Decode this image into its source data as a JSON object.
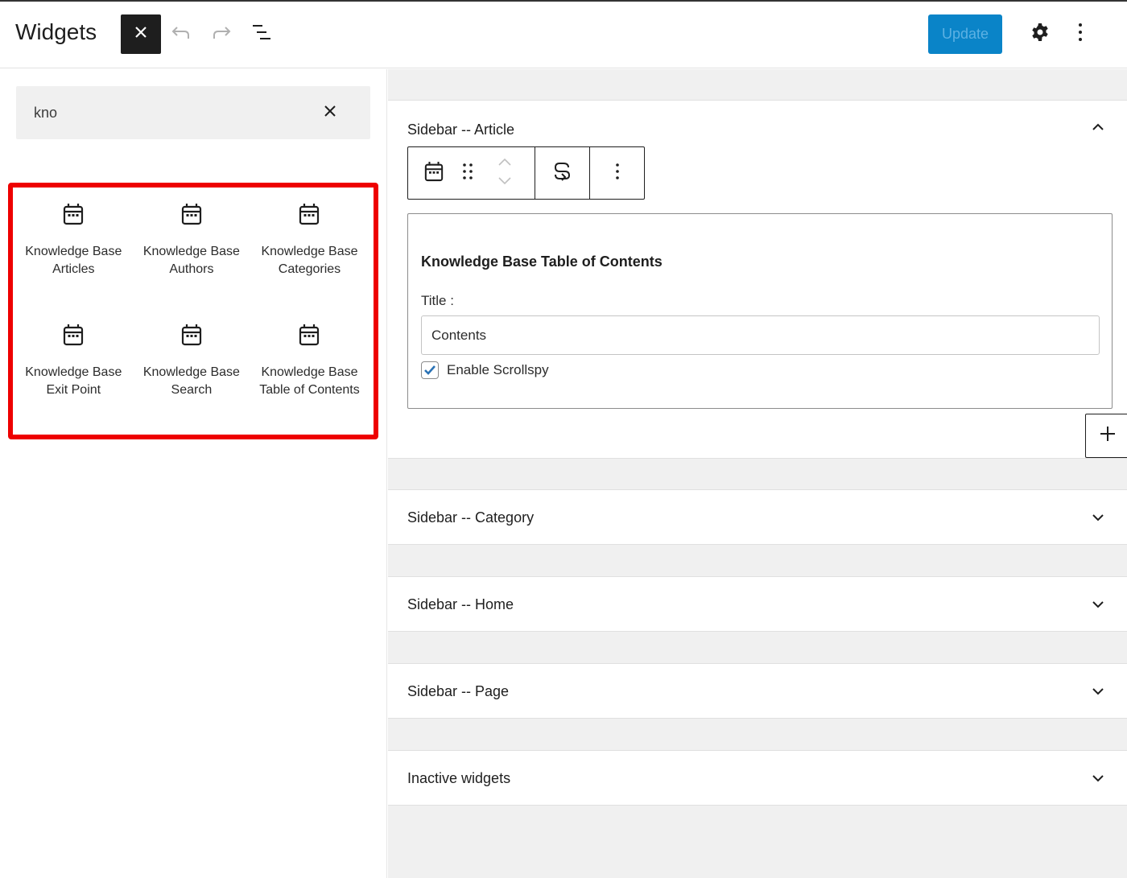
{
  "header": {
    "title": "Widgets",
    "close_inserter_icon": "close-icon",
    "undo_icon": "undo-icon",
    "redo_icon": "redo-icon",
    "list_view_icon": "list-view-icon",
    "update_label": "Update",
    "settings_icon": "gear-icon",
    "options_icon": "more-vertical-icon",
    "colors": {
      "update_bg": "#0a84c8",
      "update_text": "#5db1e3"
    }
  },
  "inserter": {
    "search": {
      "value": "kno",
      "placeholder": "Search"
    },
    "blocks": [
      {
        "label": "Knowledge Base Articles",
        "icon": "calendar-icon"
      },
      {
        "label": "Knowledge Base Authors",
        "icon": "calendar-icon"
      },
      {
        "label": "Knowledge Base Categories",
        "icon": "calendar-icon"
      },
      {
        "label": "Knowledge Base Exit Point",
        "icon": "calendar-icon"
      },
      {
        "label": "Knowledge Base Search",
        "icon": "calendar-icon"
      },
      {
        "label": "Knowledge Base Table of Contents",
        "icon": "calendar-icon"
      }
    ],
    "highlight_color": "#ee0000"
  },
  "widget_areas": {
    "article": {
      "title": "Sidebar -- Article",
      "expanded": true,
      "widget": {
        "heading": "Knowledge Base Table of Contents",
        "title_label": "Title :",
        "title_value": "Contents",
        "scrollspy_label": "Enable Scrollspy",
        "scrollspy_checked": true
      }
    },
    "collapsed": [
      {
        "title": "Sidebar -- Category"
      },
      {
        "title": "Sidebar -- Home"
      },
      {
        "title": "Sidebar -- Page"
      },
      {
        "title": "Inactive widgets"
      }
    ]
  }
}
